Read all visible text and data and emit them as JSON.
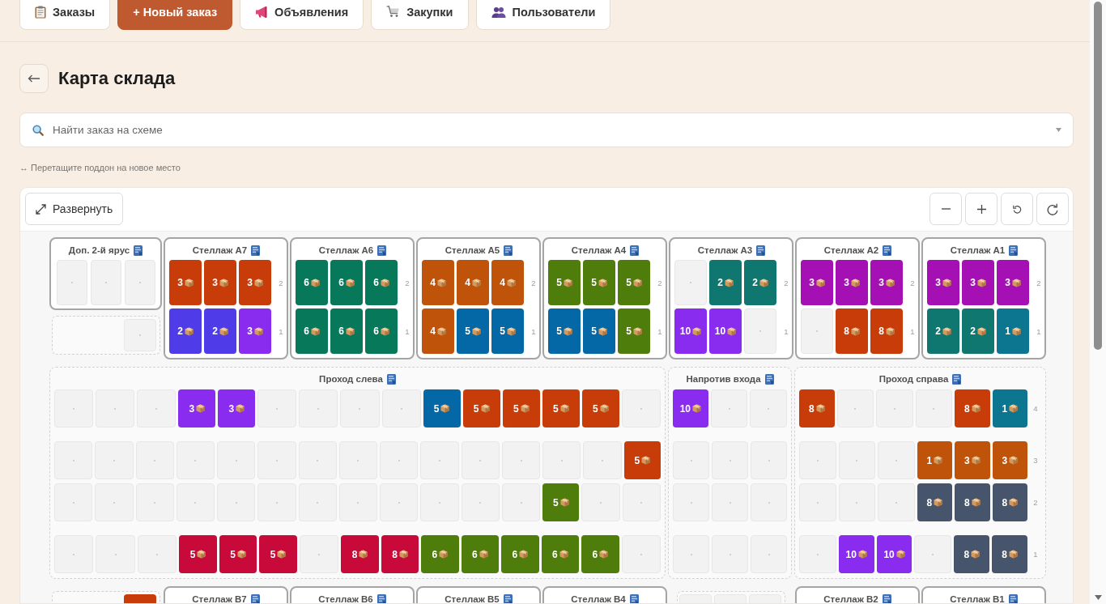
{
  "nav": [
    {
      "kind": "tab",
      "label": "Заказы"
    },
    {
      "kind": "primary",
      "label": "+ Новый заказ"
    },
    {
      "kind": "tab",
      "label": "Объявления"
    },
    {
      "kind": "tab",
      "label": "Закупки"
    },
    {
      "kind": "tab",
      "label": "Пользователи"
    }
  ],
  "page": {
    "title": "Карта склада"
  },
  "search": {
    "placeholder": "Найти заказ на схеме"
  },
  "hint": "↔ Перетащите поддон на новое место",
  "map": {
    "expand_button": "Развернуть",
    "top_row": [
      {
        "blocks": [
          {
            "kind": "rack",
            "title": "Доп. 2-й ярус",
            "levels": [
              {
                "slots": [
                  {
                    "kind": "empty"
                  },
                  {
                    "kind": "empty"
                  },
                  {
                    "kind": "empty"
                  }
                ]
              }
            ]
          },
          {
            "kind": "spare",
            "slots": [
              {
                "kind": "empty"
              }
            ]
          }
        ]
      },
      {
        "blocks": [
          {
            "kind": "rack",
            "title": "Стеллаж А7",
            "levels": [
              {
                "label": "2",
                "slots": [
                  {
                    "kind": "pallet",
                    "count": "3",
                    "color": "#c83c0a"
                  },
                  {
                    "kind": "pallet",
                    "count": "3",
                    "color": "#c83c0a"
                  },
                  {
                    "kind": "pallet",
                    "count": "3",
                    "color": "#c83c0a"
                  }
                ]
              },
              {
                "label": "1",
                "slots": [
                  {
                    "kind": "pallet",
                    "count": "2",
                    "color": "#4f3ce8"
                  },
                  {
                    "kind": "pallet",
                    "count": "2",
                    "color": "#4f3ce8"
                  },
                  {
                    "kind": "pallet",
                    "count": "3",
                    "color": "#8a2cf0"
                  }
                ]
              }
            ]
          }
        ]
      },
      {
        "blocks": [
          {
            "kind": "rack",
            "title": "Стеллаж А6",
            "levels": [
              {
                "label": "2",
                "slots": [
                  {
                    "kind": "pallet",
                    "count": "6",
                    "color": "#08785a"
                  },
                  {
                    "kind": "pallet",
                    "count": "6",
                    "color": "#08785a"
                  },
                  {
                    "kind": "pallet",
                    "count": "6",
                    "color": "#08785a"
                  }
                ]
              },
              {
                "label": "1",
                "slots": [
                  {
                    "kind": "pallet",
                    "count": "6",
                    "color": "#08785a"
                  },
                  {
                    "kind": "pallet",
                    "count": "6",
                    "color": "#08785a"
                  },
                  {
                    "kind": "pallet",
                    "count": "6",
                    "color": "#08785a"
                  }
                ]
              }
            ]
          }
        ]
      },
      {
        "blocks": [
          {
            "kind": "rack",
            "title": "Стеллаж А5",
            "levels": [
              {
                "label": "2",
                "slots": [
                  {
                    "kind": "pallet",
                    "count": "4",
                    "color": "#c0530a"
                  },
                  {
                    "kind": "pallet",
                    "count": "4",
                    "color": "#c0530a"
                  },
                  {
                    "kind": "pallet",
                    "count": "4",
                    "color": "#c0530a"
                  }
                ]
              },
              {
                "label": "1",
                "slots": [
                  {
                    "kind": "pallet",
                    "count": "4",
                    "color": "#c0530a"
                  },
                  {
                    "kind": "pallet",
                    "count": "5",
                    "color": "#0568a6"
                  },
                  {
                    "kind": "pallet",
                    "count": "5",
                    "color": "#0568a6"
                  }
                ]
              }
            ]
          }
        ]
      },
      {
        "blocks": [
          {
            "kind": "rack",
            "title": "Стеллаж А4",
            "levels": [
              {
                "label": "2",
                "slots": [
                  {
                    "kind": "pallet",
                    "count": "5",
                    "color": "#4f7d0c"
                  },
                  {
                    "kind": "pallet",
                    "count": "5",
                    "color": "#4f7d0c"
                  },
                  {
                    "kind": "pallet",
                    "count": "5",
                    "color": "#4f7d0c"
                  }
                ]
              },
              {
                "label": "1",
                "slots": [
                  {
                    "kind": "pallet",
                    "count": "5",
                    "color": "#0568a6"
                  },
                  {
                    "kind": "pallet",
                    "count": "5",
                    "color": "#0568a6"
                  },
                  {
                    "kind": "pallet",
                    "count": "5",
                    "color": "#4f7d0c"
                  }
                ]
              }
            ]
          }
        ]
      },
      {
        "blocks": [
          {
            "kind": "rack",
            "title": "Стеллаж А3",
            "levels": [
              {
                "label": "2",
                "slots": [
                  {
                    "kind": "empty"
                  },
                  {
                    "kind": "pallet",
                    "count": "2",
                    "color": "#0f7670"
                  },
                  {
                    "kind": "pallet",
                    "count": "2",
                    "color": "#0f7670"
                  }
                ]
              },
              {
                "label": "1",
                "slots": [
                  {
                    "kind": "pallet",
                    "count": "10",
                    "color": "#8a2cf0"
                  },
                  {
                    "kind": "pallet",
                    "count": "10",
                    "color": "#8a2cf0"
                  },
                  {
                    "kind": "empty"
                  }
                ]
              }
            ]
          }
        ]
      },
      {
        "blocks": [
          {
            "kind": "rack",
            "title": "Стеллаж А2",
            "levels": [
              {
                "label": "2",
                "slots": [
                  {
                    "kind": "pallet",
                    "count": "3",
                    "color": "#a410b4"
                  },
                  {
                    "kind": "pallet",
                    "count": "3",
                    "color": "#a410b4"
                  },
                  {
                    "kind": "pallet",
                    "count": "3",
                    "color": "#a410b4"
                  }
                ]
              },
              {
                "label": "1",
                "slots": [
                  {
                    "kind": "empty"
                  },
                  {
                    "kind": "pallet",
                    "count": "8",
                    "color": "#c83c0a"
                  },
                  {
                    "kind": "pallet",
                    "count": "8",
                    "color": "#c83c0a"
                  }
                ]
              }
            ]
          }
        ]
      },
      {
        "blocks": [
          {
            "kind": "rack",
            "title": "Стеллаж А1",
            "levels": [
              {
                "label": "2",
                "slots": [
                  {
                    "kind": "pallet",
                    "count": "3",
                    "color": "#a410b4"
                  },
                  {
                    "kind": "pallet",
                    "count": "3",
                    "color": "#a410b4"
                  },
                  {
                    "kind": "pallet",
                    "count": "3",
                    "color": "#a410b4"
                  }
                ]
              },
              {
                "label": "1",
                "slots": [
                  {
                    "kind": "pallet",
                    "count": "2",
                    "color": "#0f7670"
                  },
                  {
                    "kind": "pallet",
                    "count": "2",
                    "color": "#0f7670"
                  },
                  {
                    "kind": "pallet",
                    "count": "1",
                    "color": "#0c7590"
                  }
                ]
              }
            ]
          }
        ]
      }
    ],
    "aisles": [
      {
        "title": "Проход слева",
        "rows": [
          {
            "slots": [
              {
                "kind": "empty"
              },
              {
                "kind": "empty"
              },
              {
                "kind": "empty"
              },
              {
                "kind": "pallet",
                "count": "3",
                "color": "#8a2cf0"
              },
              {
                "kind": "pallet",
                "count": "3",
                "color": "#8a2cf0"
              },
              {
                "kind": "empty"
              },
              {
                "kind": "empty"
              },
              {
                "kind": "empty"
              },
              {
                "kind": "empty"
              },
              {
                "kind": "pallet",
                "count": "5",
                "color": "#0568a6"
              },
              {
                "kind": "pallet",
                "count": "5",
                "color": "#c83c0a"
              },
              {
                "kind": "pallet",
                "count": "5",
                "color": "#c83c0a"
              },
              {
                "kind": "pallet",
                "count": "5",
                "color": "#c83c0a"
              },
              {
                "kind": "pallet",
                "count": "5",
                "color": "#c83c0a"
              },
              {
                "kind": "empty"
              }
            ]
          },
          {
            "slots": [
              {
                "kind": "empty"
              },
              {
                "kind": "empty"
              },
              {
                "kind": "empty"
              },
              {
                "kind": "empty"
              },
              {
                "kind": "empty"
              },
              {
                "kind": "empty"
              },
              {
                "kind": "empty"
              },
              {
                "kind": "empty"
              },
              {
                "kind": "empty"
              },
              {
                "kind": "empty"
              },
              {
                "kind": "empty"
              },
              {
                "kind": "empty"
              },
              {
                "kind": "empty"
              },
              {
                "kind": "empty"
              },
              {
                "kind": "pallet",
                "count": "5",
                "color": "#c83c0a"
              }
            ]
          },
          {
            "slots": [
              {
                "kind": "empty"
              },
              {
                "kind": "empty"
              },
              {
                "kind": "empty"
              },
              {
                "kind": "empty"
              },
              {
                "kind": "empty"
              },
              {
                "kind": "empty"
              },
              {
                "kind": "empty"
              },
              {
                "kind": "empty"
              },
              {
                "kind": "empty"
              },
              {
                "kind": "empty"
              },
              {
                "kind": "empty"
              },
              {
                "kind": "empty"
              },
              {
                "kind": "pallet",
                "count": "5",
                "color": "#4f7d0c"
              },
              {
                "kind": "empty"
              },
              {
                "kind": "empty"
              }
            ]
          },
          {
            "slots": [
              {
                "kind": "empty"
              },
              {
                "kind": "empty"
              },
              {
                "kind": "empty"
              },
              {
                "kind": "pallet",
                "count": "5",
                "color": "#c70a3a"
              },
              {
                "kind": "pallet",
                "count": "5",
                "color": "#c70a3a"
              },
              {
                "kind": "pallet",
                "count": "5",
                "color": "#c70a3a"
              },
              {
                "kind": "empty"
              },
              {
                "kind": "pallet",
                "count": "8",
                "color": "#c70a3a"
              },
              {
                "kind": "pallet",
                "count": "8",
                "color": "#c70a3a"
              },
              {
                "kind": "pallet",
                "count": "6",
                "color": "#4f7d0c"
              },
              {
                "kind": "pallet",
                "count": "6",
                "color": "#4f7d0c"
              },
              {
                "kind": "pallet",
                "count": "6",
                "color": "#4f7d0c"
              },
              {
                "kind": "pallet",
                "count": "6",
                "color": "#4f7d0c"
              },
              {
                "kind": "pallet",
                "count": "6",
                "color": "#4f7d0c"
              },
              {
                "kind": "empty"
              }
            ]
          }
        ]
      },
      {
        "title": "Напротив входа",
        "rows": [
          {
            "slots": [
              {
                "kind": "pallet",
                "count": "10",
                "color": "#8a2cf0"
              },
              {
                "kind": "empty"
              },
              {
                "kind": "empty"
              }
            ]
          },
          {
            "slots": [
              {
                "kind": "empty"
              },
              {
                "kind": "empty"
              },
              {
                "kind": "empty"
              }
            ]
          },
          {
            "slots": [
              {
                "kind": "empty"
              },
              {
                "kind": "empty"
              },
              {
                "kind": "empty"
              }
            ]
          },
          {
            "slots": [
              {
                "kind": "empty"
              },
              {
                "kind": "empty"
              },
              {
                "kind": "empty"
              }
            ]
          }
        ]
      },
      {
        "title": "Проход справа",
        "rows": [
          {
            "label": "4",
            "slots": [
              {
                "kind": "pallet",
                "count": "8",
                "color": "#c83c0a"
              },
              {
                "kind": "empty"
              },
              {
                "kind": "empty"
              },
              {
                "kind": "empty"
              },
              {
                "kind": "pallet",
                "count": "8",
                "color": "#c83c0a"
              },
              {
                "kind": "pallet",
                "count": "1",
                "color": "#0c7590"
              }
            ]
          },
          {
            "label": "3",
            "slots": [
              {
                "kind": "empty"
              },
              {
                "kind": "empty"
              },
              {
                "kind": "empty"
              },
              {
                "kind": "pallet",
                "count": "1",
                "color": "#c0530a"
              },
              {
                "kind": "pallet",
                "count": "3",
                "color": "#c0530a"
              },
              {
                "kind": "pallet",
                "count": "3",
                "color": "#c0530a"
              }
            ]
          },
          {
            "label": "2",
            "slots": [
              {
                "kind": "empty"
              },
              {
                "kind": "empty"
              },
              {
                "kind": "empty"
              },
              {
                "kind": "pallet",
                "count": "8",
                "color": "#46556b"
              },
              {
                "kind": "pallet",
                "count": "8",
                "color": "#46556b"
              },
              {
                "kind": "pallet",
                "count": "8",
                "color": "#46556b"
              }
            ]
          },
          {
            "label": "1",
            "slots": [
              {
                "kind": "empty"
              },
              {
                "kind": "pallet",
                "count": "10",
                "color": "#8a2cf0"
              },
              {
                "kind": "pallet",
                "count": "10",
                "color": "#8a2cf0"
              },
              {
                "kind": "empty"
              },
              {
                "kind": "pallet",
                "count": "8",
                "color": "#46556b"
              },
              {
                "kind": "pallet",
                "count": "8",
                "color": "#46556b"
              }
            ]
          }
        ]
      }
    ],
    "bottom_row": [
      {
        "blocks": [
          {
            "kind": "spare",
            "slots": [
              {
                "kind": "pallet",
                "color": "#c83c0a"
              }
            ]
          }
        ]
      },
      {
        "blocks": [
          {
            "kind": "rack",
            "title": "Стеллаж В7"
          }
        ]
      },
      {
        "blocks": [
          {
            "kind": "rack",
            "title": "Стеллаж В6"
          }
        ]
      },
      {
        "blocks": [
          {
            "kind": "rack",
            "title": "Стеллаж В5"
          }
        ]
      },
      {
        "blocks": [
          {
            "kind": "rack",
            "title": "Стеллаж В4"
          }
        ]
      },
      {
        "blocks": [
          {
            "kind": "spare",
            "slots": [
              {
                "kind": "empty"
              },
              {
                "kind": "empty"
              },
              {
                "kind": "empty"
              }
            ]
          }
        ]
      },
      {
        "blocks": [
          {
            "kind": "rack",
            "title": "Стеллаж В2"
          }
        ]
      },
      {
        "blocks": [
          {
            "kind": "rack",
            "title": "Стеллаж В1"
          }
        ]
      }
    ]
  }
}
